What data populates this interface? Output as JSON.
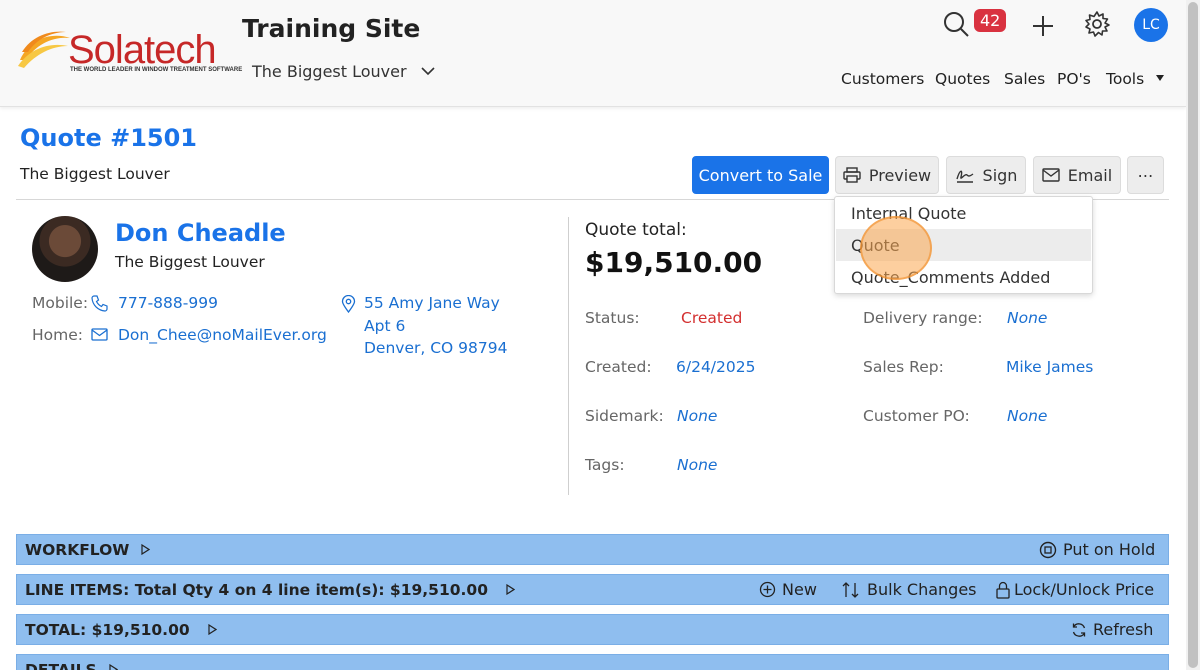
{
  "header": {
    "logo_text": "Solatech",
    "logo_tagline": "THE WORLD LEADER IN WINDOW TREATMENT SOFTWARE",
    "site_title": "Training Site",
    "site_subtitle": "The Biggest Louver",
    "notification_count": "42",
    "avatar_initials": "LC",
    "nav": [
      "Customers",
      "Quotes",
      "Sales",
      "PO's",
      "Tools"
    ]
  },
  "quote": {
    "title": "Quote #1501",
    "subtitle": "The Biggest Louver",
    "buttons": {
      "convert": "Convert to Sale",
      "preview": "Preview",
      "sign": "Sign",
      "email": "Email",
      "more": "⋯"
    }
  },
  "customer": {
    "name": "Don Cheadle",
    "company": "The Biggest Louver",
    "mobile_label": "Mobile:",
    "mobile": "777-888-999",
    "home_label": "Home:",
    "email": "Don_Chee@noMailEver.org",
    "address_line1": "55 Amy Jane Way",
    "address_line2": "Apt 6",
    "address_line3": "Denver, CO 98794"
  },
  "details": {
    "total_label": "Quote total:",
    "total_value": "$19,510.00",
    "status_label": "Status:",
    "status_value": "Created",
    "created_label": "Created:",
    "created_value": "6/24/2025",
    "sidemark_label": "Sidemark:",
    "sidemark_value": "None",
    "tags_label": "Tags:",
    "tags_value": "None",
    "delivery_label": "Delivery range:",
    "delivery_value": "None",
    "salesrep_label": "Sales Rep:",
    "salesrep_value": "Mike James",
    "customerpo_label": "Customer PO:",
    "customerpo_value": "None"
  },
  "dropdown": {
    "items": [
      "Internal Quote",
      "Quote",
      "Quote_Comments Added"
    ]
  },
  "sections": {
    "workflow": {
      "title": "WORKFLOW",
      "action": "Put on Hold"
    },
    "line_items": {
      "title": "LINE ITEMS: Total Qty 4 on 4 line item(s): $19,510.00",
      "new": "New",
      "bulk": "Bulk Changes",
      "lock": "Lock/Unlock Price"
    },
    "total": {
      "title": "TOTAL: $19,510.00",
      "refresh": "Refresh"
    },
    "details": {
      "title": "DETAILS"
    }
  },
  "colors": {
    "accent": "#1a73e8",
    "bar": "#8fbeef",
    "badge": "#d93240",
    "status_created": "#d32f2f"
  }
}
